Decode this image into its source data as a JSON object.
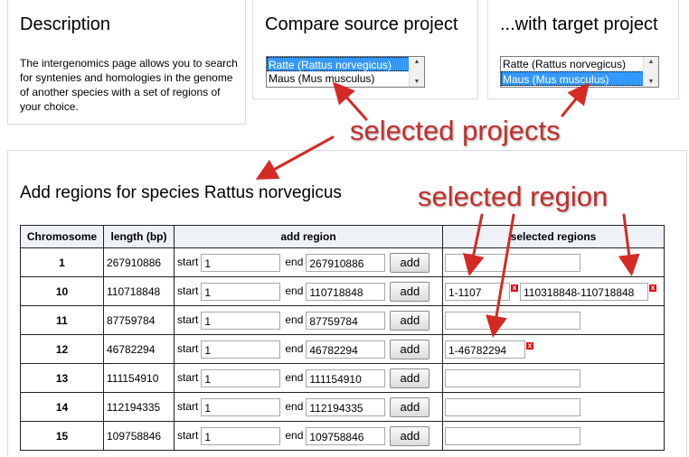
{
  "description": {
    "title": "Description",
    "text": "The intergenomics page allows you to search for syntenies and homologies in the genome of another species with a set of regions of your choice."
  },
  "source_project": {
    "title": "Compare source project",
    "options": [
      "Ratte (Rattus norvegicus)",
      "Maus (Mus musculus)"
    ],
    "selected_index": 0
  },
  "target_project": {
    "title": "...with target project",
    "options": [
      "Ratte (Rattus norvegicus)",
      "Maus (Mus musculus)"
    ],
    "selected_index": 1
  },
  "annotations": {
    "selected_projects": "selected projects",
    "selected_region": "selected region"
  },
  "regions": {
    "title": "Add regions for species Rattus norvegicus",
    "headers": [
      "Chromosome",
      "length (bp)",
      "add region",
      "selected regions"
    ],
    "start_label": "start",
    "end_label": "end",
    "add_label": "add",
    "remove_icon": "x",
    "rows": [
      {
        "chromosome": "1",
        "length": "267910886",
        "start": "1",
        "end": "267910886",
        "selected": []
      },
      {
        "chromosome": "10",
        "length": "110718848",
        "start": "1",
        "end": "110718848",
        "selected": [
          "1-1107",
          "110318848-110718848"
        ]
      },
      {
        "chromosome": "11",
        "length": "87759784",
        "start": "1",
        "end": "87759784",
        "selected": []
      },
      {
        "chromosome": "12",
        "length": "46782294",
        "start": "1",
        "end": "46782294",
        "selected": [
          "1-46782294"
        ]
      },
      {
        "chromosome": "13",
        "length": "111154910",
        "start": "1",
        "end": "111154910",
        "selected": []
      },
      {
        "chromosome": "14",
        "length": "112194335",
        "start": "1",
        "end": "112194335",
        "selected": []
      },
      {
        "chromosome": "15",
        "length": "109758846",
        "start": "1",
        "end": "109758846",
        "selected": []
      }
    ]
  },
  "colors": {
    "annotation": "#c0302e",
    "selection": "#3399ff",
    "remove": "#e01010"
  }
}
